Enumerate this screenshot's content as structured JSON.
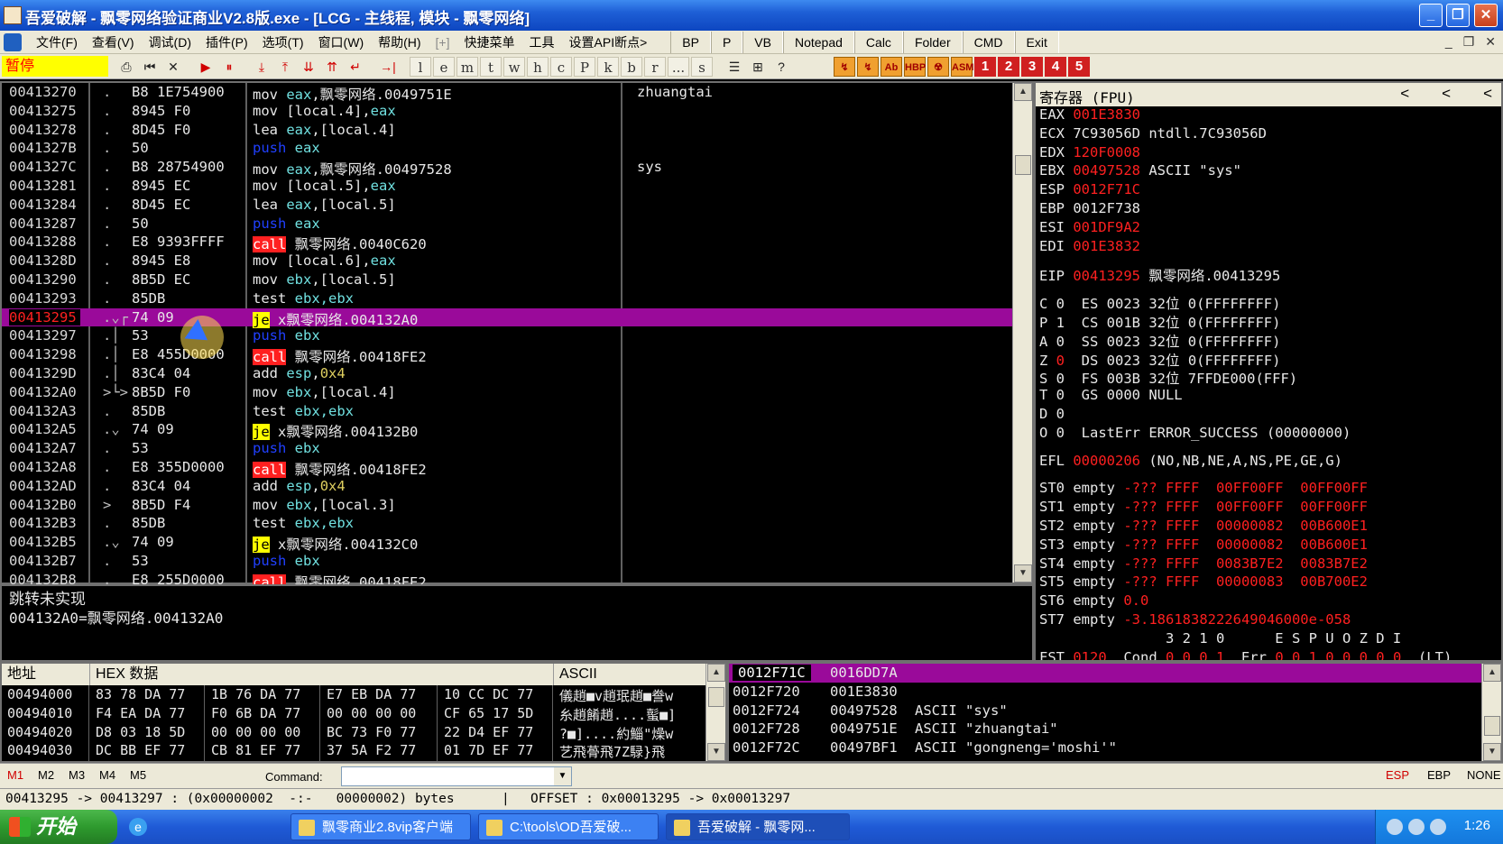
{
  "window": {
    "title": "吾爱破解 - 飘零网络验证商业V2.8版.exe - [LCG - 主线程, 模块 - 飘零网络]",
    "controls": [
      "_",
      "❐",
      "✕"
    ]
  },
  "menu": {
    "items": [
      "文件(F)",
      "查看(V)",
      "调试(D)",
      "插件(P)",
      "选项(T)",
      "窗口(W)",
      "帮助(H)",
      "[+]",
      "快捷菜单",
      "工具",
      "设置API断点>"
    ],
    "quick_buttons": [
      "BP",
      "P",
      "VB",
      "Notepad",
      "Calc",
      "Folder",
      "CMD",
      "Exit"
    ]
  },
  "toolbar": {
    "status": "暂停",
    "buttons": [
      "⎙",
      "⏮",
      "✕",
      "▶",
      "⏸",
      "⤓",
      "⤒",
      "⇊",
      "⇈",
      "↵",
      "→|"
    ],
    "letters": [
      "l",
      "e",
      "m",
      "t",
      "w",
      "h",
      "c",
      "P",
      "k",
      "b",
      "r",
      "...",
      "s"
    ],
    "plugins": [
      "☰",
      "⊞",
      "?"
    ],
    "plugin2": [
      "↯",
      "↯",
      "Ab",
      "HBP",
      "☢",
      "ASM"
    ],
    "numbered": [
      "1",
      "2",
      "3",
      "4",
      "5"
    ]
  },
  "disasm": {
    "rows": [
      {
        "addr": "00413270",
        "arrow": ".",
        "hex": "B8 1E754900",
        "op": "mov",
        "args": [
          {
            "t": "eax",
            "c": "reg"
          },
          {
            "t": ",飘零网络.0049751E",
            "c": "txt"
          }
        ],
        "comment": "zhuangtai"
      },
      {
        "addr": "00413275",
        "arrow": ".",
        "hex": "8945 F0",
        "op": "mov",
        "args": [
          {
            "t": "[local.4],",
            "c": "txt"
          },
          {
            "t": "eax",
            "c": "reg"
          }
        ],
        "comment": ""
      },
      {
        "addr": "00413278",
        "arrow": ".",
        "hex": "8D45 F0",
        "op": "lea",
        "args": [
          {
            "t": "eax",
            "c": "reg"
          },
          {
            "t": ",[local.4]",
            "c": "txt"
          }
        ],
        "comment": ""
      },
      {
        "addr": "0041327B",
        "arrow": ".",
        "hex": "50",
        "op": "push",
        "args": [
          {
            "t": "eax",
            "c": "reg"
          }
        ],
        "comment": ""
      },
      {
        "addr": "0041327C",
        "arrow": ".",
        "hex": "B8 28754900",
        "op": "mov",
        "args": [
          {
            "t": "eax",
            "c": "reg"
          },
          {
            "t": ",飘零网络.00497528",
            "c": "txt"
          }
        ],
        "comment": "sys"
      },
      {
        "addr": "00413281",
        "arrow": ".",
        "hex": "8945 EC",
        "op": "mov",
        "args": [
          {
            "t": "[local.5],",
            "c": "txt"
          },
          {
            "t": "eax",
            "c": "reg"
          }
        ],
        "comment": ""
      },
      {
        "addr": "00413284",
        "arrow": ".",
        "hex": "8D45 EC",
        "op": "lea",
        "args": [
          {
            "t": "eax",
            "c": "reg"
          },
          {
            "t": ",[local.5]",
            "c": "txt"
          }
        ],
        "comment": ""
      },
      {
        "addr": "00413287",
        "arrow": ".",
        "hex": "50",
        "op": "push",
        "args": [
          {
            "t": "eax",
            "c": "reg"
          }
        ],
        "comment": ""
      },
      {
        "addr": "00413288",
        "arrow": ".",
        "hex": "E8 9393FFFF",
        "op": "call",
        "args": [
          {
            "t": "飘零网络.0040C620",
            "c": "txt"
          }
        ],
        "comment": ""
      },
      {
        "addr": "0041328D",
        "arrow": ".",
        "hex": "8945 E8",
        "op": "mov",
        "args": [
          {
            "t": "[local.6],",
            "c": "txt"
          },
          {
            "t": "eax",
            "c": "reg"
          }
        ],
        "comment": ""
      },
      {
        "addr": "00413290",
        "arrow": ".",
        "hex": "8B5D EC",
        "op": "mov",
        "args": [
          {
            "t": "ebx",
            "c": "reg"
          },
          {
            "t": ",[local.5]",
            "c": "txt"
          }
        ],
        "comment": ""
      },
      {
        "addr": "00413293",
        "arrow": ".",
        "hex": "85DB",
        "op": "test",
        "args": [
          {
            "t": "ebx,ebx",
            "c": "reg"
          }
        ],
        "comment": ""
      },
      {
        "addr": "00413295",
        "arrow": ".⌄┌",
        "hex": "74 09",
        "op": "je",
        "args": [
          {
            "t": "x飘零网络.004132A0",
            "c": "txt"
          }
        ],
        "comment": "",
        "selected": true
      },
      {
        "addr": "00413297",
        "arrow": ".│",
        "hex": "53",
        "op": "push",
        "args": [
          {
            "t": "ebx",
            "c": "reg"
          }
        ],
        "comment": ""
      },
      {
        "addr": "00413298",
        "arrow": ".│",
        "hex": "E8 455D0000",
        "op": "call",
        "args": [
          {
            "t": "飘零网络.00418FE2",
            "c": "txt"
          }
        ],
        "comment": ""
      },
      {
        "addr": "0041329D",
        "arrow": ".│",
        "hex": "83C4 04",
        "op": "add",
        "args": [
          {
            "t": "esp",
            "c": "reg"
          },
          {
            "t": ",",
            "c": "txt"
          },
          {
            "t": "0x4",
            "c": "imm"
          }
        ],
        "comment": ""
      },
      {
        "addr": "004132A0",
        "arrow": ">└>",
        "hex": "8B5D F0",
        "op": "mov",
        "args": [
          {
            "t": "ebx",
            "c": "reg"
          },
          {
            "t": ",[local.4]",
            "c": "txt"
          }
        ],
        "comment": ""
      },
      {
        "addr": "004132A3",
        "arrow": ".",
        "hex": "85DB",
        "op": "test",
        "args": [
          {
            "t": "ebx,ebx",
            "c": "reg"
          }
        ],
        "comment": ""
      },
      {
        "addr": "004132A5",
        "arrow": ".⌄",
        "hex": "74 09",
        "op": "je",
        "args": [
          {
            "t": "x飘零网络.004132B0",
            "c": "txt"
          }
        ],
        "comment": ""
      },
      {
        "addr": "004132A7",
        "arrow": ".",
        "hex": "53",
        "op": "push",
        "args": [
          {
            "t": "ebx",
            "c": "reg"
          }
        ],
        "comment": ""
      },
      {
        "addr": "004132A8",
        "arrow": ".",
        "hex": "E8 355D0000",
        "op": "call",
        "args": [
          {
            "t": "飘零网络.00418FE2",
            "c": "txt"
          }
        ],
        "comment": ""
      },
      {
        "addr": "004132AD",
        "arrow": ".",
        "hex": "83C4 04",
        "op": "add",
        "args": [
          {
            "t": "esp",
            "c": "reg"
          },
          {
            "t": ",",
            "c": "txt"
          },
          {
            "t": "0x4",
            "c": "imm"
          }
        ],
        "comment": ""
      },
      {
        "addr": "004132B0",
        "arrow": ">",
        "hex": "8B5D F4",
        "op": "mov",
        "args": [
          {
            "t": "ebx",
            "c": "reg"
          },
          {
            "t": ",[local.3]",
            "c": "txt"
          }
        ],
        "comment": ""
      },
      {
        "addr": "004132B3",
        "arrow": ".",
        "hex": "85DB",
        "op": "test",
        "args": [
          {
            "t": "ebx,ebx",
            "c": "reg"
          }
        ],
        "comment": ""
      },
      {
        "addr": "004132B5",
        "arrow": ".⌄",
        "hex": "74 09",
        "op": "je",
        "args": [
          {
            "t": "x飘零网络.004132C0",
            "c": "txt"
          }
        ],
        "comment": ""
      },
      {
        "addr": "004132B7",
        "arrow": ".",
        "hex": "53",
        "op": "push",
        "args": [
          {
            "t": "ebx",
            "c": "reg"
          }
        ],
        "comment": ""
      },
      {
        "addr": "004132B8",
        "arrow": ".",
        "hex": "E8 255D0000",
        "op": "call",
        "args": [
          {
            "t": "飘零网络.00418FE2",
            "c": "txt"
          }
        ],
        "comment": ""
      }
    ]
  },
  "info": {
    "line1": "跳转未实现",
    "line2": "004132A0=飘零网络.004132A0"
  },
  "registers": {
    "title": "寄存器 (FPU)",
    "arrows": [
      "<",
      "<",
      "<"
    ],
    "lines": [
      [
        {
          "t": "EAX ",
          "c": "n"
        },
        {
          "t": "001E3830",
          "c": "v"
        }
      ],
      [
        {
          "t": "ECX ",
          "c": "n"
        },
        {
          "t": "7C93056D",
          "c": "w"
        },
        {
          "t": " ntdll.7C93056D",
          "c": "x"
        }
      ],
      [
        {
          "t": "EDX ",
          "c": "n"
        },
        {
          "t": "120F0008",
          "c": "v"
        }
      ],
      [
        {
          "t": "EBX ",
          "c": "n"
        },
        {
          "t": "00497528",
          "c": "v"
        },
        {
          "t": " ASCII \"sys\"",
          "c": "x"
        }
      ],
      [
        {
          "t": "ESP ",
          "c": "n"
        },
        {
          "t": "0012F71C",
          "c": "v"
        }
      ],
      [
        {
          "t": "EBP ",
          "c": "n"
        },
        {
          "t": "0012F738",
          "c": "w"
        }
      ],
      [
        {
          "t": "ESI ",
          "c": "n"
        },
        {
          "t": "001DF9A2",
          "c": "v"
        }
      ],
      [
        {
          "t": "EDI ",
          "c": "n"
        },
        {
          "t": "001E3832",
          "c": "v"
        }
      ],
      "gap",
      [
        {
          "t": "EIP ",
          "c": "n"
        },
        {
          "t": "00413295",
          "c": "v"
        },
        {
          "t": " 飘零网络.00413295",
          "c": "x"
        }
      ],
      "gap",
      [
        {
          "t": "C 0  ES 0023 32位 0(FFFFFFFF)",
          "c": "x"
        }
      ],
      [
        {
          "t": "P 1  CS 001B 32位 0(FFFFFFFF)",
          "c": "x"
        }
      ],
      [
        {
          "t": "A 0  SS 0023 32位 0(FFFFFFFF)",
          "c": "x"
        }
      ],
      [
        {
          "t": "Z ",
          "c": "x"
        },
        {
          "t": "0",
          "c": "v"
        },
        {
          "t": "  DS 0023 32位 0(FFFFFFFF)",
          "c": "x"
        }
      ],
      [
        {
          "t": "S 0  FS 003B 32位 7FFDE000(FFF)",
          "c": "x"
        }
      ],
      [
        {
          "t": "T 0  GS 0000 NULL",
          "c": "x"
        }
      ],
      [
        {
          "t": "D 0",
          "c": "x"
        }
      ],
      [
        {
          "t": "O 0  LastErr ERROR_SUCCESS (00000000)",
          "c": "x"
        }
      ],
      "gap",
      [
        {
          "t": "EFL ",
          "c": "n"
        },
        {
          "t": "00000206",
          "c": "v"
        },
        {
          "t": " (NO,NB,NE,A,NS,PE,GE,G)",
          "c": "x"
        }
      ],
      "gap",
      [
        {
          "t": "ST0 empty ",
          "c": "x"
        },
        {
          "t": "-??? FFFF  00FF00FF  00FF00FF",
          "c": "v"
        }
      ],
      [
        {
          "t": "ST1 empty ",
          "c": "x"
        },
        {
          "t": "-??? FFFF  00FF00FF  00FF00FF",
          "c": "v"
        }
      ],
      [
        {
          "t": "ST2 empty ",
          "c": "x"
        },
        {
          "t": "-??? FFFF  00000082  00B600E1",
          "c": "v"
        }
      ],
      [
        {
          "t": "ST3 empty ",
          "c": "x"
        },
        {
          "t": "-??? FFFF  00000082  00B600E1",
          "c": "v"
        }
      ],
      [
        {
          "t": "ST4 empty ",
          "c": "x"
        },
        {
          "t": "-??? FFFF  0083B7E2  0083B7E2",
          "c": "v"
        }
      ],
      [
        {
          "t": "ST5 empty ",
          "c": "x"
        },
        {
          "t": "-??? FFFF  00000083  00B700E2",
          "c": "v"
        }
      ],
      [
        {
          "t": "ST6 empty ",
          "c": "x"
        },
        {
          "t": "0.0",
          "c": "v"
        }
      ],
      [
        {
          "t": "ST7 empty ",
          "c": "x"
        },
        {
          "t": "-3.1861838222649046000e-058",
          "c": "v"
        }
      ],
      [
        {
          "t": "               3 2 1 0      E S P U O Z D I",
          "c": "x"
        }
      ],
      [
        {
          "t": "FST ",
          "c": "x"
        },
        {
          "t": "0120",
          "c": "v"
        },
        {
          "t": "  Cond ",
          "c": "x"
        },
        {
          "t": "0 0 0 1",
          "c": "v"
        },
        {
          "t": "  Err ",
          "c": "x"
        },
        {
          "t": "0 0 1 0 0 0 0 0",
          "c": "v"
        },
        {
          "t": "  (LT)",
          "c": "x"
        }
      ]
    ]
  },
  "dump": {
    "headers": [
      "地址",
      "HEX 数据",
      "ASCII"
    ],
    "rows": [
      {
        "addr": "00494000",
        "h1": "83 78 DA 77",
        "h2": "1B 76 DA 77",
        "h3": "E7 EB DA 77",
        "h4": "10 CC DC 77",
        "ascii": "儀趙■v趙珉趙■誊w"
      },
      {
        "addr": "00494010",
        "h1": "F4 EA DA 77",
        "h2": "F0 6B DA 77",
        "h3": "00 00 00 00",
        "h4": "CF 65 17 5D",
        "ascii": "糸趙餚趙....蟚■]"
      },
      {
        "addr": "00494020",
        "h1": "D8 03 18 5D",
        "h2": "00 00 00 00",
        "h3": "BC 73 F0 77",
        "h4": "22 D4 EF 77",
        "ascii": "?■]....約鯔\"燥w"
      },
      {
        "addr": "00494030",
        "h1": "DC BB EF 77",
        "h2": "CB 81 EF 77",
        "h3": "37 5A F2 77",
        "h4": "01 7D EF 77",
        "ascii": "艺飛蓇飛7Z騄}飛"
      }
    ]
  },
  "stack": {
    "rows": [
      {
        "addr": "0012F71C",
        "val": "0016DD7A",
        "comment": "",
        "selected": true
      },
      {
        "addr": "0012F720",
        "val": "001E3830",
        "comment": ""
      },
      {
        "addr": "0012F724",
        "val": "00497528",
        "comment": "ASCII \"sys\""
      },
      {
        "addr": "0012F728",
        "val": "0049751E",
        "comment": "ASCII \"zhuangtai\""
      },
      {
        "addr": "0012F72C",
        "val": "00497BF1",
        "comment": "ASCII \"gongneng='moshi'\""
      }
    ]
  },
  "cmdbar": {
    "markers": [
      "M1",
      "M2",
      "M3",
      "M4",
      "M5"
    ],
    "command_label": "Command:",
    "command_value": "",
    "right": [
      "ESP",
      "EBP",
      "NONE"
    ]
  },
  "statusline": {
    "left": "00413295 -> 00413297 : (0x00000002  -:-   00000002) bytes",
    "sep": "|",
    "right": "OFFSET : 0x00013295 -> 0x00013297"
  },
  "taskbar": {
    "start": "开始",
    "tasks": [
      "飘零商业2.8vip客户端",
      "C:\\tools\\OD吾爱破...",
      "吾爱破解 - 飘零网..."
    ],
    "clock": "1:26"
  },
  "colors": {
    "selection": "#9a0a9a",
    "register_changed": "#ff2020",
    "pause_bg": "#ffff00"
  }
}
